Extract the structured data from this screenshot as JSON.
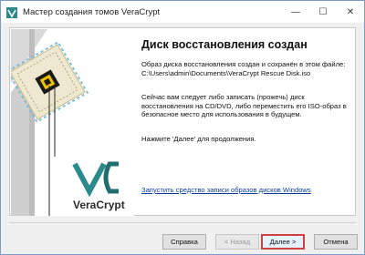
{
  "window": {
    "title": "Мастер создания томов VeraCrypt",
    "controls": {
      "minimize": "—",
      "maximize": "☐",
      "close": "✕"
    }
  },
  "graphic": {
    "logo_text": "VeraCrypt",
    "icon": "chip-key-icon"
  },
  "main": {
    "heading": "Диск восстановления создан",
    "paragraph1_line1": "Образ диска восстановления создан и сохранён в этом файле:",
    "paragraph1_line2": "C:\\Users\\admin\\Documents\\VeraCrypt Rescue Disk.iso",
    "paragraph2": "Сейчас вам следует либо записать (прожечь) диск восстановления на CD/DVD, либо переместить его ISO-образ в безопасное место для использования в будущем.",
    "paragraph3": "Нажмите 'Далее' для продолжения.",
    "link": "Запустить средство записи образов дисков Windows"
  },
  "buttons": {
    "help": "Справка",
    "back": "< Назад",
    "next": "Далее >",
    "cancel": "Отмена"
  },
  "colors": {
    "accent_teal": "#2a8a8c",
    "highlight_border": "#d04040",
    "link": "#0b3c9c"
  }
}
